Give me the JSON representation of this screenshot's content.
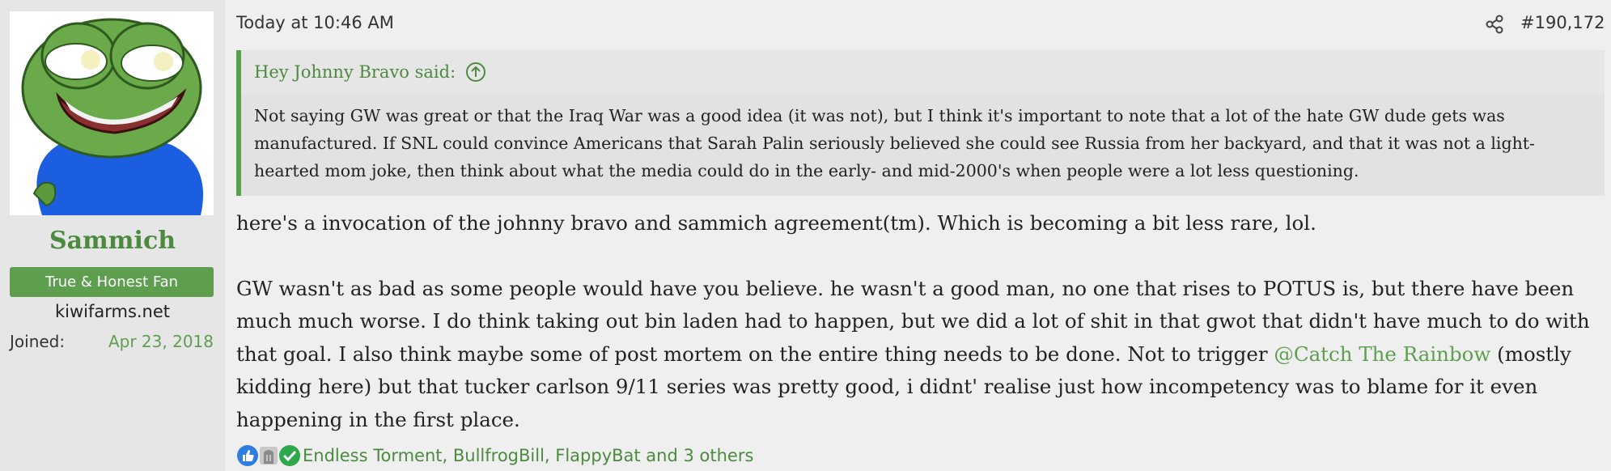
{
  "author": {
    "username": "Sammich",
    "user_title": "True & Honest Fan",
    "site": "kiwifarms.net",
    "joined_label": "Joined:",
    "joined_date": "Apr 23, 2018"
  },
  "post": {
    "timestamp": "Today at 10:46 AM",
    "number": "#190,172"
  },
  "quote": {
    "author_said": "Hey Johnny Bravo said:",
    "body": "Not saying GW was great or that the Iraq War was a good idea (it was not), but I think it's important to note that a lot of the hate GW dude gets was manufactured. If SNL could convince Americans that Sarah Palin seriously believed she could see Russia from her backyard, and that it was not a light-hearted mom joke, then think about what the media could do in the early- and mid-2000's when people were a lot less questioning."
  },
  "message": {
    "paragraph1": "here's a invocation of the johnny bravo and sammich agreement(tm). Which is becoming a bit less rare, lol.",
    "paragraph2_before": "GW wasn't as bad as some people would have you believe. he wasn't a good man, no one that rises to POTUS is, but there have been much much worse. I do think taking out bin laden had to happen, but we did a lot of shit in that gwot that didn't have much to do with that goal. I also think maybe some of post mortem on the entire thing needs to be done. Not to trigger ",
    "mention": "@Catch The Rainbow",
    "paragraph2_after": " (mostly kidding here) but that tucker carlson 9/11 series was pretty good, i didnt' realise just how incompetency was to blame for it even happening in the first place."
  },
  "reactions": {
    "icons": [
      "thumbs-up-icon",
      "tombstone-icon",
      "checkmark-icon"
    ],
    "text": "Endless Torment, BullfrogBill, FlappyBat and 3 others"
  },
  "colors": {
    "accent": "#5e9e4f",
    "username": "#4c8a3f",
    "background": "#efefef",
    "sidebar": "#e6e6e6"
  }
}
